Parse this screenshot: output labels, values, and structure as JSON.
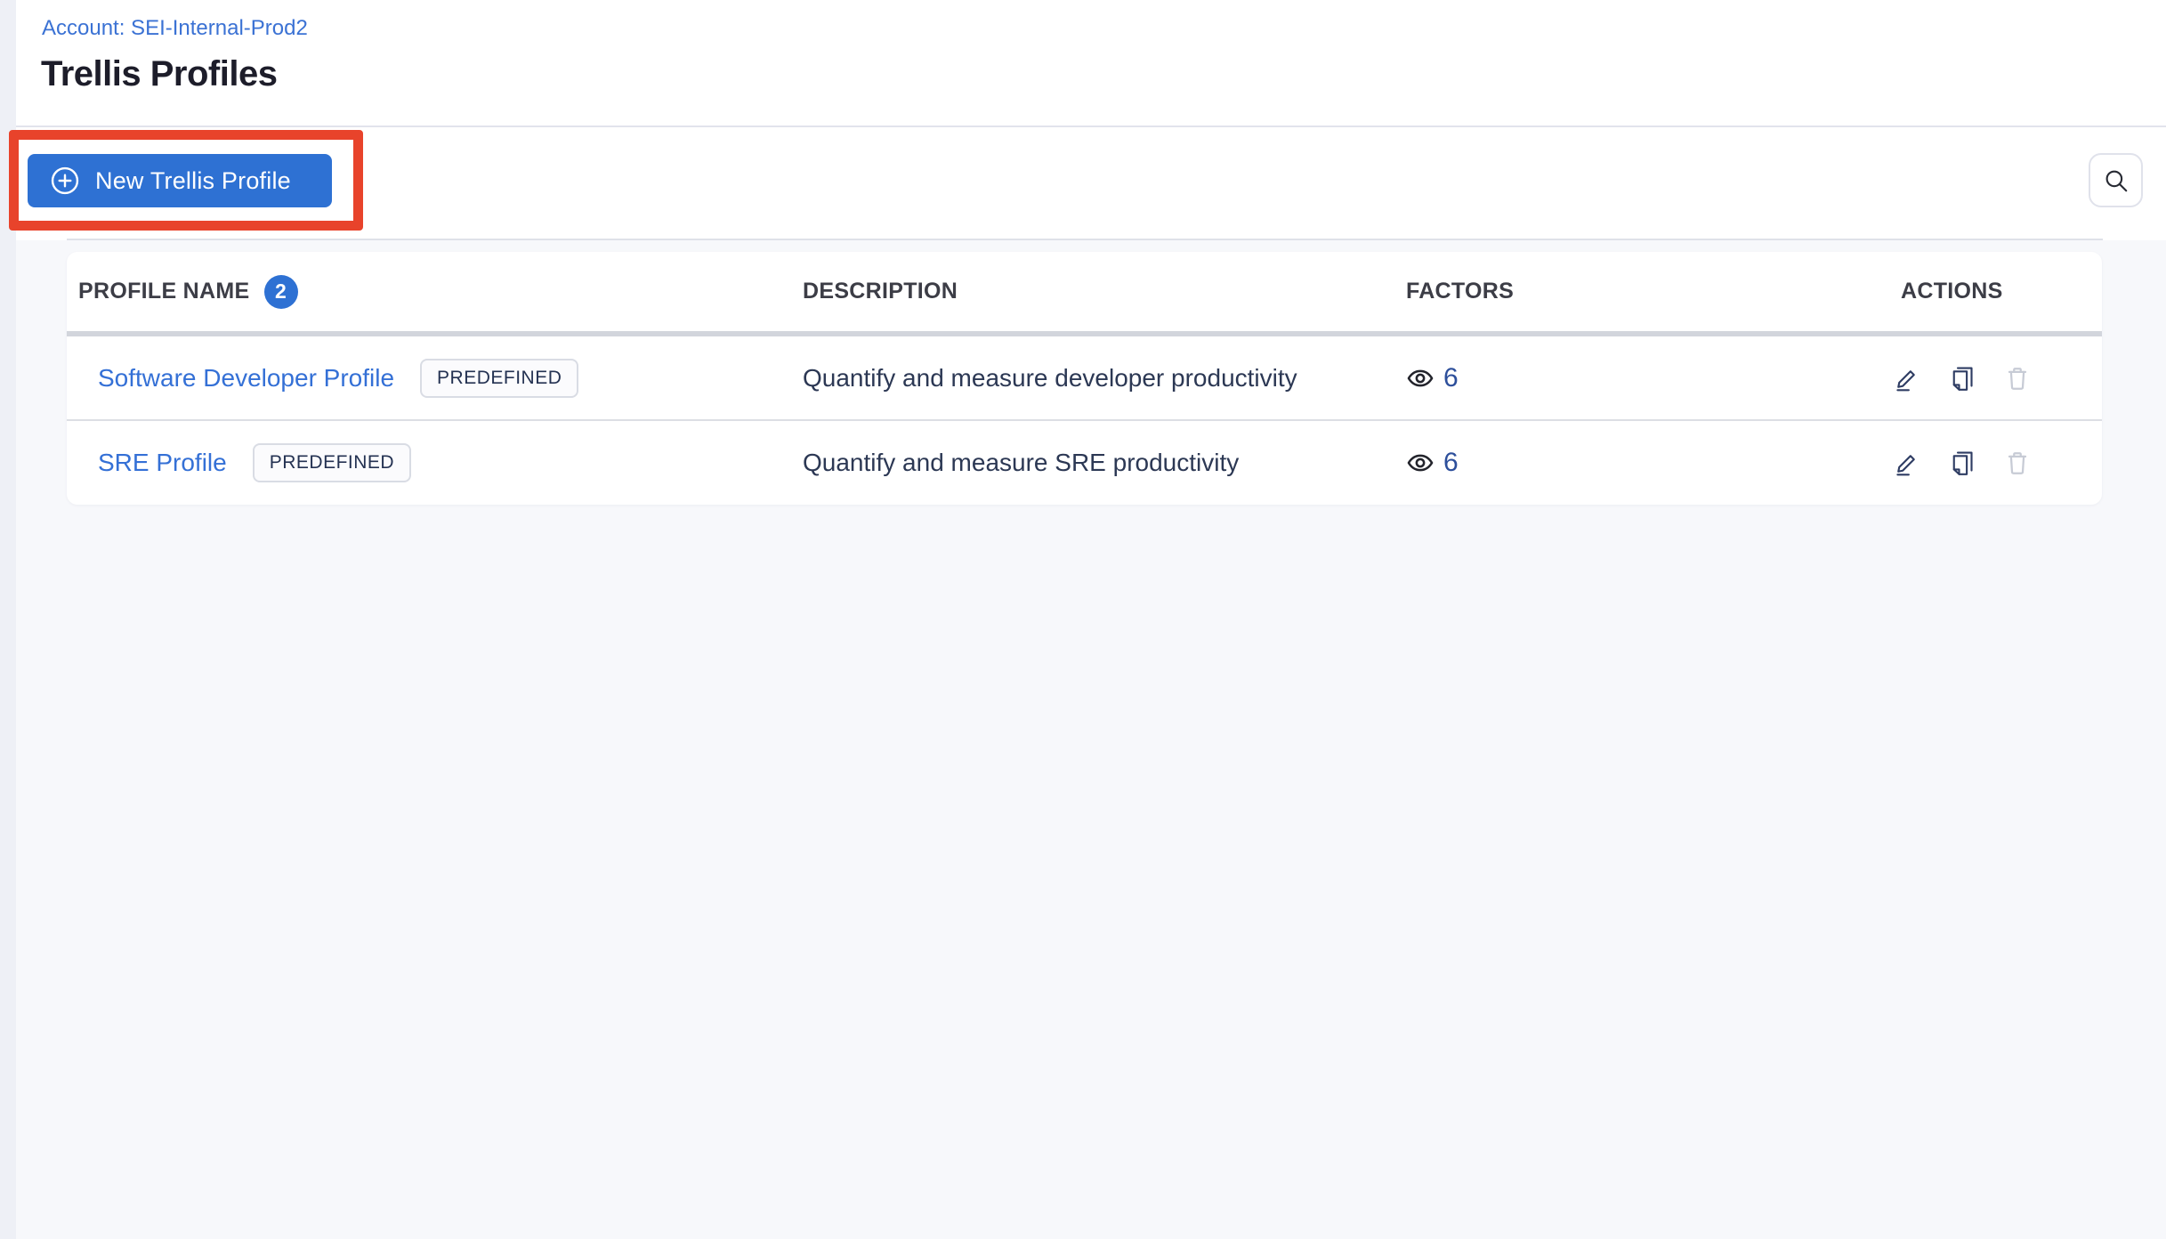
{
  "page": {
    "breadcrumb": "Account: SEI-Internal-Prod2",
    "title": "Trellis Profiles"
  },
  "toolbar": {
    "new_profile_button": "New Trellis Profile",
    "icons": {
      "plus_circle": "plus-circle-icon",
      "search": "search-icon"
    }
  },
  "table": {
    "headers": {
      "name": "PROFILE NAME",
      "count": "2",
      "description": "DESCRIPTION",
      "factors": "FACTORS",
      "actions": "ACTIONS"
    },
    "rows": [
      {
        "name": "Software Developer Profile",
        "tag": "PREDEFINED",
        "description": "Quantify and measure developer productivity",
        "factors": "6"
      },
      {
        "name": "SRE Profile",
        "tag": "PREDEFINED",
        "description": "Quantify and measure SRE productivity",
        "factors": "6"
      }
    ],
    "row_icons": [
      "eye-icon",
      "edit-icon",
      "copy-icon",
      "delete-icon"
    ]
  },
  "annotation": {
    "type": "highlight-box",
    "target": "new-trellis-profile-button",
    "color": "#e8432b"
  },
  "colors": {
    "primary_blue": "#2e71d3",
    "link_blue": "#3470d6",
    "breadcrumb_blue": "#3b72d4",
    "title_text": "#1d1d2a",
    "header_text": "#3c3d46",
    "description_text": "#2c3854",
    "factor_count_text": "#2d4f9b",
    "content_background": "#f7f8fb",
    "card_background": "#ffffff",
    "divider": "#e2e3ec",
    "header_bar": "#d2d5dc",
    "disabled_icon": "#c7cbd5",
    "annotation_red": "#e8432b"
  }
}
